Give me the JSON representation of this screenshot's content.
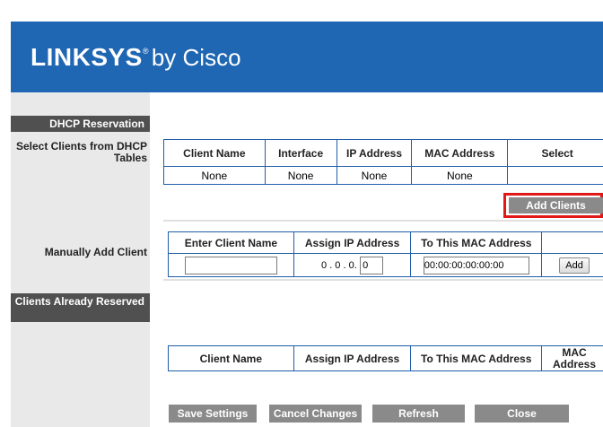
{
  "header": {
    "brand": "LINKSYS",
    "reg_mark": "®",
    "by": "by Cisco"
  },
  "left": {
    "dhcp_reservation": "DHCP Reservation",
    "select_clients": "Select Clients from DHCP Tables",
    "manually_add": "Manually Add Client",
    "clients_reserved": "Clients Already Reserved"
  },
  "dhcp_table": {
    "headers": [
      "Client Name",
      "Interface",
      "IP Address",
      "MAC Address",
      "Select"
    ],
    "row": [
      "None",
      "None",
      "None",
      "None",
      ""
    ]
  },
  "add_clients_button": "Add Clients",
  "manual_table": {
    "headers": [
      "Enter Client Name",
      "Assign IP Address",
      "To This MAC Address",
      ""
    ],
    "client_name_value": "",
    "ip_prefix": "0 . 0 . 0.",
    "ip_last_octet": "0",
    "mac_value": "00:00:00:00:00:00",
    "add_button": "Add"
  },
  "reserved_table": {
    "headers": [
      "Client Name",
      "Assign IP Address",
      "To This MAC Address",
      "MAC Address"
    ]
  },
  "footer": {
    "save": "Save Settings",
    "cancel": "Cancel Changes",
    "refresh": "Refresh",
    "close": "Close"
  }
}
